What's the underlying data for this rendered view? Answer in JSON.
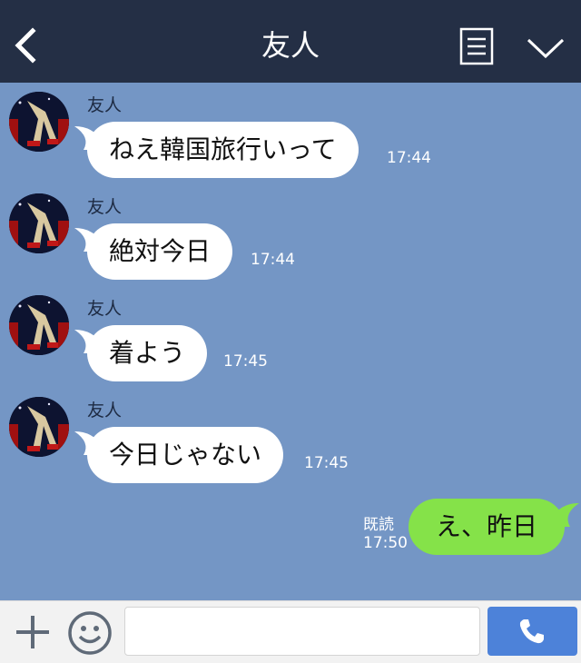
{
  "header": {
    "title": "友人",
    "back_icon": "chevron-left-icon",
    "menu_icon": "menu-list-icon",
    "expand_icon": "chevron-down-icon"
  },
  "messages": [
    {
      "sender": "友人",
      "text": "ねえ韓国旅行いって",
      "time": "17:44"
    },
    {
      "sender": "友人",
      "text": "絶対今日",
      "time": "17:44"
    },
    {
      "sender": "友人",
      "text": "着よう",
      "time": "17:45"
    },
    {
      "sender": "友人",
      "text": "今日じゃない",
      "time": "17:45"
    }
  ],
  "outgoing": {
    "text": "え、昨日",
    "read_label": "既読",
    "time": "17:50"
  },
  "footer": {
    "plus_icon": "plus-icon",
    "emoji_icon": "smiley-icon",
    "input_value": "",
    "input_placeholder": "",
    "call_icon": "phone-icon"
  },
  "colors": {
    "header_bg": "#242f45",
    "chat_bg": "#7496c5",
    "incoming_bubble": "#ffffff",
    "outgoing_bubble": "#85e249",
    "call_button": "#4d82d9"
  }
}
